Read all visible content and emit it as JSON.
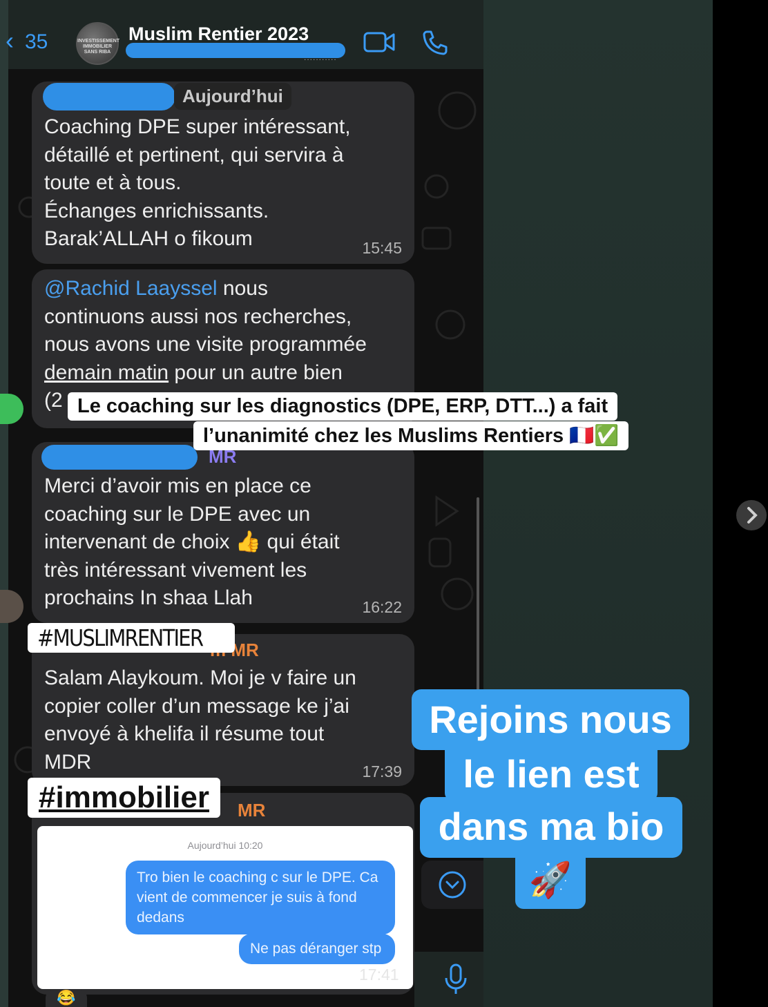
{
  "header": {
    "back_count": "35",
    "group_name": "Muslim Rentier 2023",
    "avatar_text": "INVESTISSEMENT IMMOBILIER SANS RIBA",
    "subtitle": "..........."
  },
  "date_chip": "Aujourd’hui",
  "messages": [
    {
      "lines": [
        "Coaching DPE super intéressant,",
        "détaillé et pertinent, qui servira à",
        "toute et à tous.",
        "Échanges enrichissants.",
        "Barak’ALLAH o fikoum"
      ],
      "time": "15:45"
    },
    {
      "mention": "@Rachid Laayssel",
      "line1_rest": " nous",
      "line2": "continuons aussi nos recherches,",
      "line3": "nous avons une visite programmée",
      "underlined": "demain matin",
      "line4_rest": " pour un autre bien",
      "line5": "(2"
    },
    {
      "sender_suffix": "MR",
      "lines": [
        "Merci d’avoir mis en place ce",
        "coaching sur le DPE avec un",
        "intervenant de choix 👍 qui était",
        "très intéressant vivement les",
        "prochains In shaa Llah"
      ],
      "time": "16:22"
    },
    {
      "sender_suffix": "m MR",
      "lines": [
        "Salam Alaykoum. Moi je v faire un",
        "copier coller d’un message ke j’ai",
        "envoyé à khelifa il résume tout",
        "MDR"
      ],
      "time": "17:39"
    },
    {
      "sender_suffix": "MR",
      "time": "17:41"
    }
  ],
  "inner_screenshot": {
    "timestamp": "Aujourd’hui 10:20",
    "bubble1": "Tro bien le coaching c sur le DPE. Ca vient de commencer je suis à fond dedans",
    "bubble2": "Ne pas déranger stp"
  },
  "overlay_caption": {
    "line1": "Le coaching sur les diagnostics (DPE, ERP, DTT...) a fait",
    "line2": "l’unanimité chez les Muslims Rentiers 🇫🇷✅"
  },
  "tags": {
    "tag1": "#MUSLIMRENTIER",
    "tag2": "#immobilier"
  },
  "cta": {
    "line1": "Rejoins nous",
    "line2": "le lien est",
    "line3": "dans ma bio",
    "emoji": "🚀"
  },
  "icons": [
    "back-chevron-icon",
    "video-call-icon",
    "phone-call-icon",
    "scroll-down-icon",
    "microphone-icon",
    "next-arrow-icon"
  ],
  "colors": {
    "accent_blue": "#3b9bf5",
    "bubble_bg": "#2c2c2e",
    "cta_blue": "#3aa0ee",
    "imessage_blue": "#3a8ff4"
  }
}
